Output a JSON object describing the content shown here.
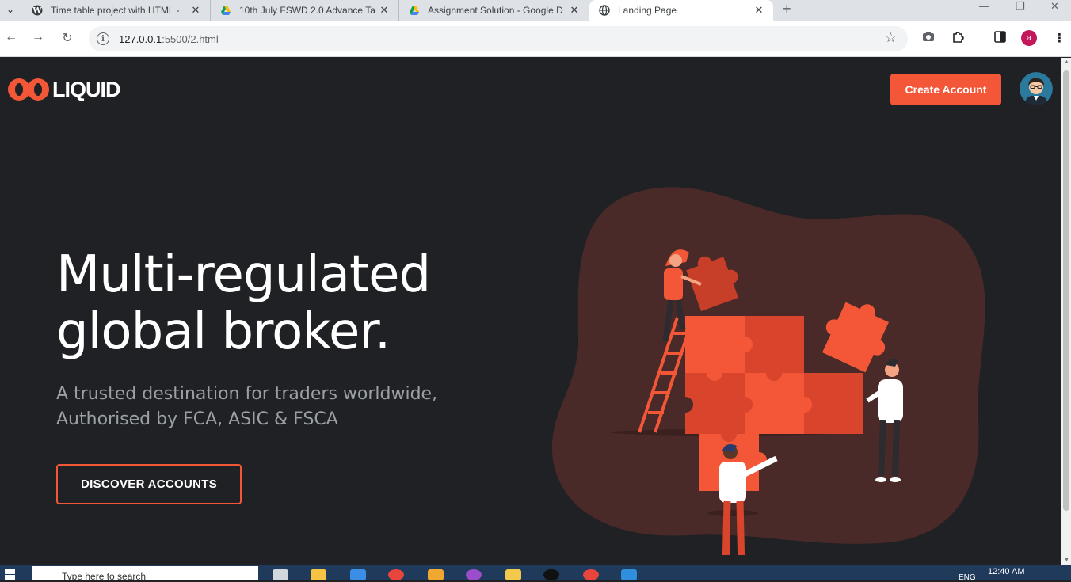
{
  "browser": {
    "tabs": [
      {
        "title": "Time table project with HTML -",
        "icon": "wordpress-icon",
        "active": false
      },
      {
        "title": "10th July FSWD 2.0 Advance Ta",
        "icon": "google-drive-icon",
        "active": false
      },
      {
        "title": "Assignment Solution - Google D",
        "icon": "google-drive-icon",
        "active": false
      },
      {
        "title": "Landing Page",
        "icon": "globe-icon",
        "active": true
      }
    ],
    "url_host": "127.0.0.1",
    "url_path": ":5500/2.html",
    "profile_initial": "a"
  },
  "page": {
    "logo_text": "LIQUID",
    "create_account_label": "Create Account",
    "headline_line1": "Multi-regulated",
    "headline_line2": "global broker.",
    "subtitle_line1": "A trusted destination for traders worldwide,",
    "subtitle_line2": "Authorised by FCA, ASIC & FSCA",
    "discover_label": "DISCOVER ACCOUNTS",
    "accent_color": "#f45737",
    "background_color": "#202124"
  },
  "taskbar": {
    "search_placeholder": "Type here to search",
    "language": "ENG",
    "time": "12:40 AM"
  }
}
